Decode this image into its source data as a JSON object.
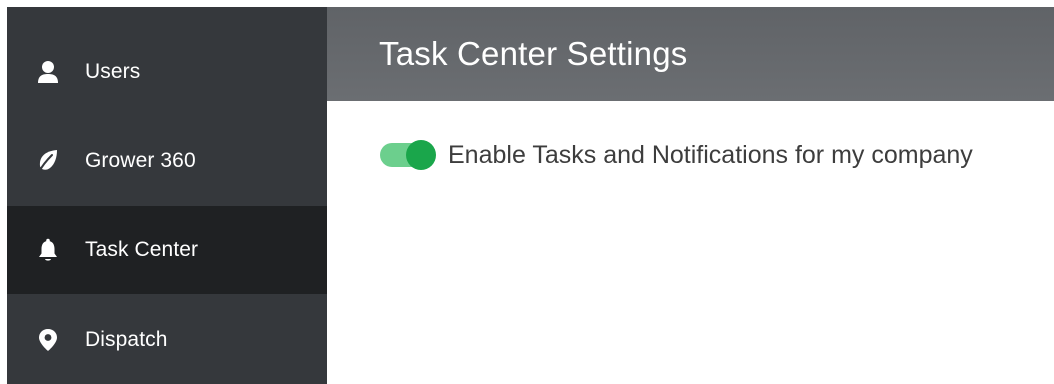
{
  "sidebar": {
    "items": [
      {
        "label": "Users",
        "icon": "user-icon"
      },
      {
        "label": "Grower 360",
        "icon": "leaf-icon"
      },
      {
        "label": "Task Center",
        "icon": "bell-icon"
      },
      {
        "label": "Dispatch",
        "icon": "map-pin-icon"
      }
    ],
    "active_item": "Task Center"
  },
  "header": {
    "title": "Task Center Settings"
  },
  "settings": {
    "enable_tasks_label": "Enable Tasks and Notifications for my company",
    "enable_tasks_on": true
  },
  "colors": {
    "sidebar_bg": "#35383c",
    "sidebar_active_bg": "#1f2123",
    "header_bg": "#65686c",
    "toggle_on": "#1aa64b",
    "toggle_track": "#6ccf8d"
  }
}
